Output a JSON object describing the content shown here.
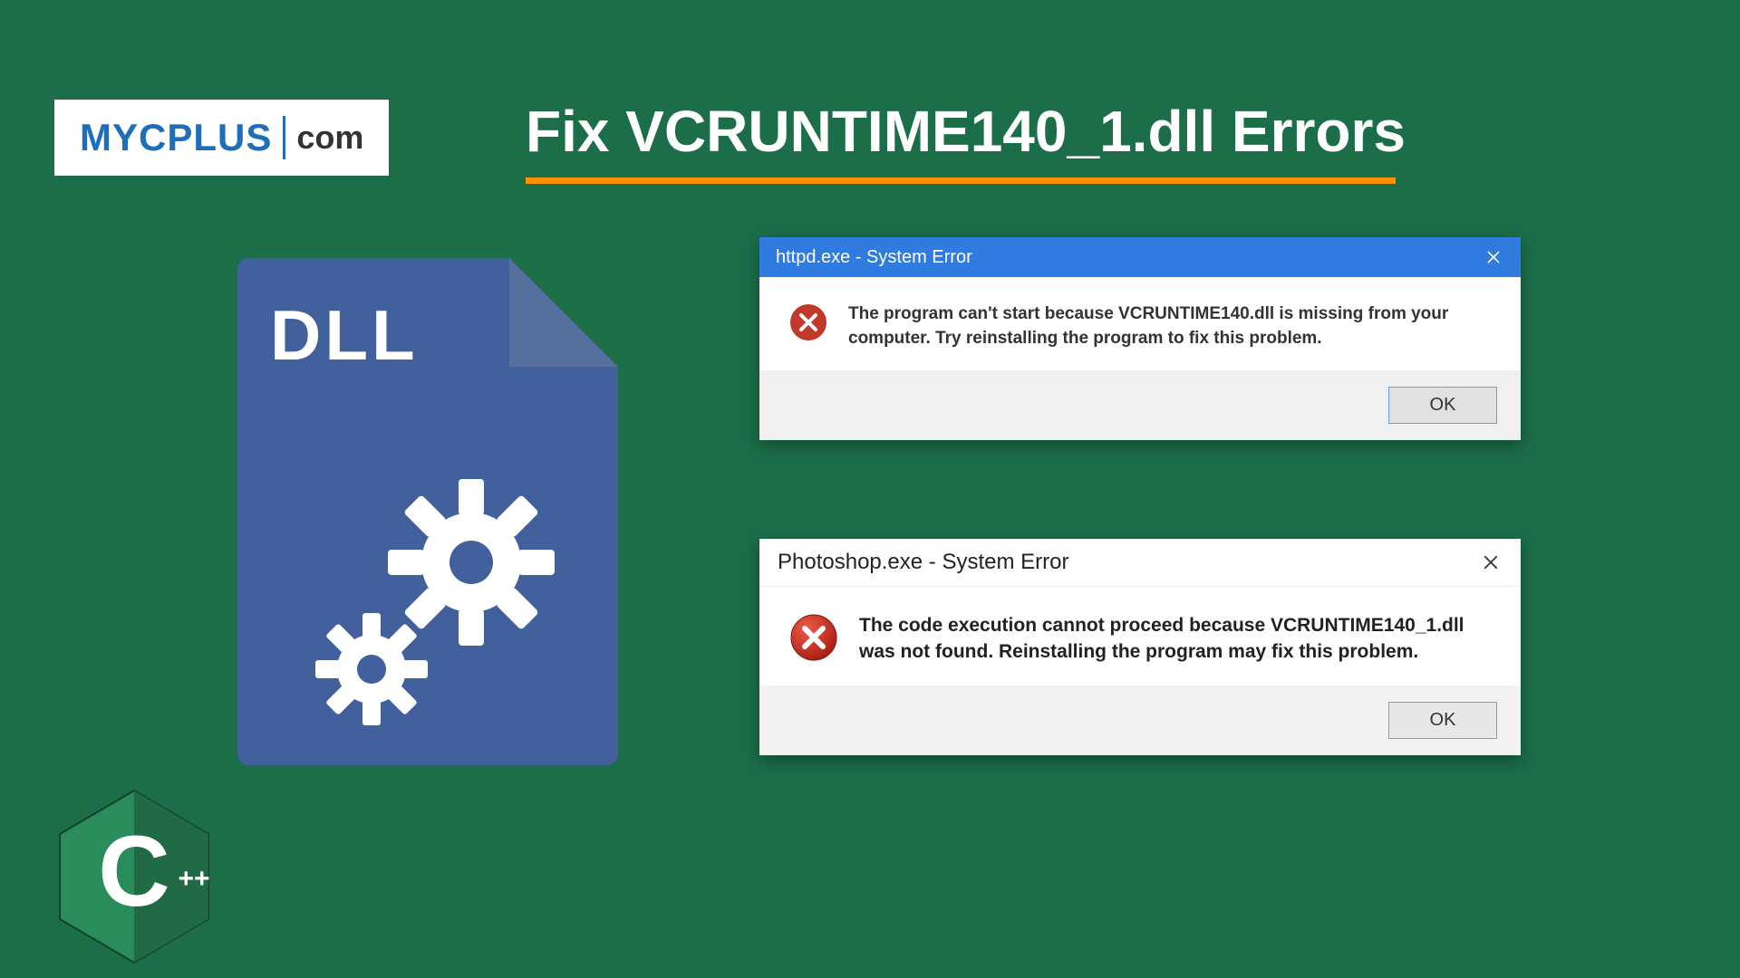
{
  "logo": {
    "main": "MYCPLUS",
    "sub": "com"
  },
  "title": "Fix VCRUNTIME140_1.dll Errors",
  "dll": {
    "label": "DLL"
  },
  "dialog1": {
    "title": "httpd.exe - System Error",
    "message": "The program can't start because VCRUNTIME140.dll is missing from your computer. Try reinstalling the program to fix this problem.",
    "ok": "OK"
  },
  "dialog2": {
    "title": "Photoshop.exe - System Error",
    "message": "The code execution cannot proceed because VCRUNTIME140_1.dll was not found. Reinstalling the program may fix this problem.",
    "ok": "OK"
  },
  "cpp_badge": {
    "letter": "C",
    "plus": "++"
  }
}
